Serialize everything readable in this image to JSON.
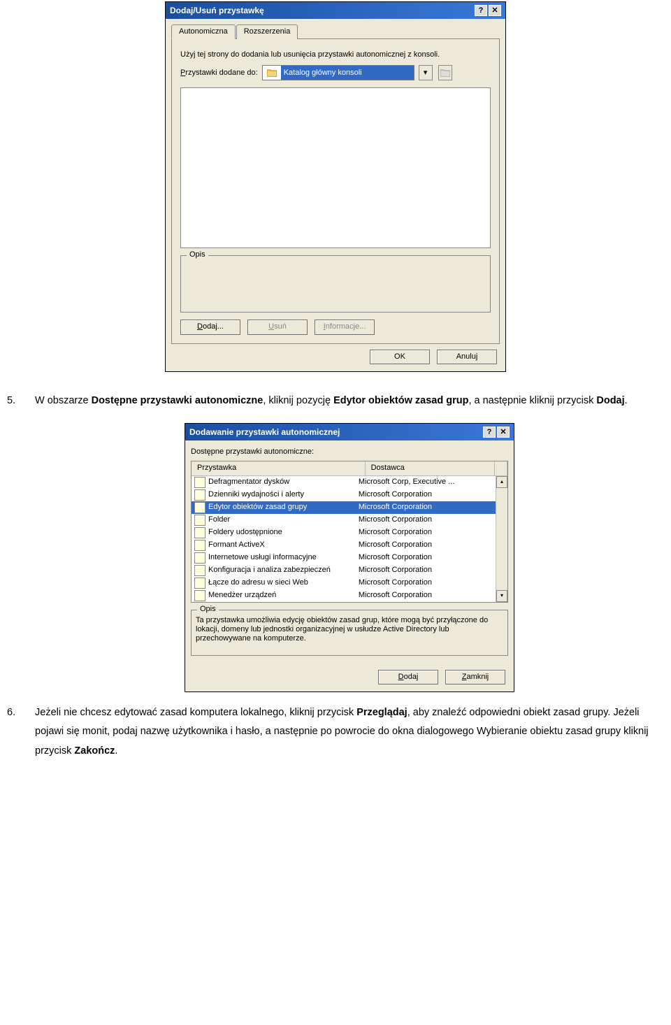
{
  "dialog1": {
    "title": "Dodaj/Usuń przystawkę",
    "tabs": {
      "tab1": "Autonomiczna",
      "tab2": "Rozszerzenia"
    },
    "intro": "Użyj tej strony do dodania lub usunięcia przystawki autonomicznej z konsoli.",
    "added_label_pre": "P",
    "added_label": "rzystawki dodane do:",
    "combobox_value": "Katalog główny konsoli",
    "desc_group": "Opis",
    "add_btn_pre": "D",
    "add_btn": "odaj...",
    "remove_btn_pre": "U",
    "remove_btn": "suń",
    "info_btn_pre": "I",
    "info_btn": "nformacje...",
    "ok_btn": "OK",
    "cancel_btn": "Anuluj"
  },
  "doc5": {
    "num": "5.",
    "t1": "W obszarze ",
    "b1": "Dostępne przystawki autonomiczne",
    "t2": ", kliknij pozycję ",
    "b2": "Edytor obiektów zasad grup",
    "t3": ", a następnie kliknij przycisk ",
    "b3": "Dodaj",
    "t4": "."
  },
  "dialog2": {
    "title": "Dodawanie przystawki autonomicznej",
    "available_label": "Dostępne przystawki autonomiczne:",
    "col_name": "Przystawka",
    "col_vendor": "Dostawca",
    "rows": [
      {
        "name": "Defragmentator dysków",
        "vendor": "Microsoft Corp, Executive ..."
      },
      {
        "name": "Dzienniki wydajności i alerty",
        "vendor": "Microsoft Corporation"
      },
      {
        "name": "Edytor obiektów zasad grupy",
        "vendor": "Microsoft Corporation"
      },
      {
        "name": "Folder",
        "vendor": "Microsoft Corporation"
      },
      {
        "name": "Foldery udostępnione",
        "vendor": "Microsoft Corporation"
      },
      {
        "name": "Formant ActiveX",
        "vendor": "Microsoft Corporation"
      },
      {
        "name": "Internetowe usługi informacyjne",
        "vendor": "Microsoft Corporation"
      },
      {
        "name": "Konfiguracja i analiza zabezpieczeń",
        "vendor": "Microsoft Corporation"
      },
      {
        "name": "Łącze do adresu w sieci Web",
        "vendor": "Microsoft Corporation"
      },
      {
        "name": "Menedżer urządzeń",
        "vendor": "Microsoft Corporation"
      }
    ],
    "selected_index": 2,
    "desc_group": "Opis",
    "desc_text": "Ta przystawka umożliwia edycję obiektów zasad grup, które mogą być przyłączone do lokacji, domeny lub jednostki organizacyjnej w usłudze Active Directory lub przechowywane na komputerze.",
    "add_btn_pre": "D",
    "add_btn": "odaj",
    "close_btn_pre": "Z",
    "close_btn": "amknij"
  },
  "doc6": {
    "num": "6.",
    "t1": "Jeżeli nie chcesz edytować zasad komputera lokalnego, kliknij przycisk ",
    "b1": "Przeglądaj",
    "t2": ", aby znaleźć odpowiedni obiekt zasad grupy. Jeżeli pojawi się monit, podaj nazwę użytkownika i hasło, a następnie po powrocie do okna dialogowego Wybieranie obiektu zasad grupy kliknij przycisk ",
    "b2": "Zakończ",
    "t3": "."
  }
}
